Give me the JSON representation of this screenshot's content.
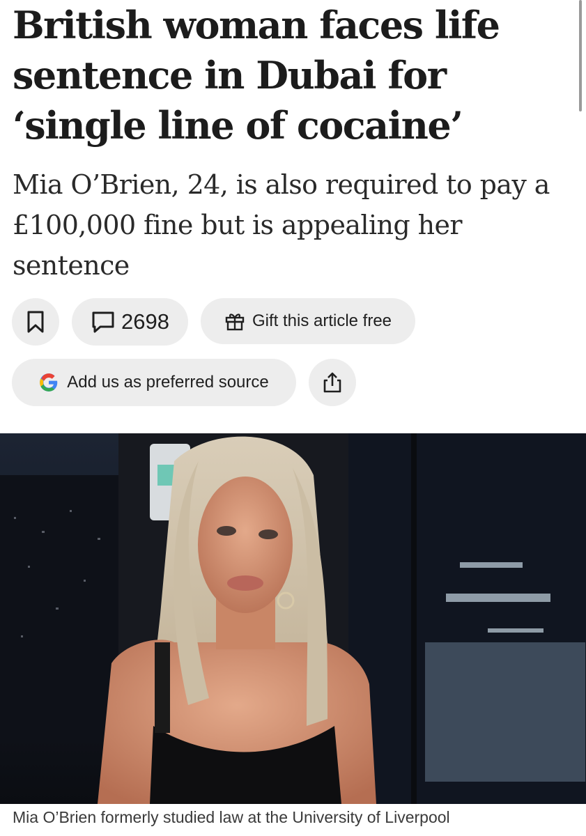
{
  "article": {
    "headline": "British woman faces life sentence in Dubai for ‘single line of cocaine’",
    "standfirst": "Mia O’Brien, 24, is also required to pay a £100,000 fine but is appealing her sentence"
  },
  "actions": {
    "comment_count": "2698",
    "gift_label": "Gift this article free",
    "preferred_source_label": "Add us as preferred source"
  },
  "icons": {
    "save": "bookmark-icon",
    "comments": "comment-bubble-icon",
    "gift": "gift-icon",
    "google": "google-g-icon",
    "share": "share-icon"
  },
  "image": {
    "caption": "Mia O’Brien formerly studied law at the University of Liverpool"
  },
  "colors": {
    "pill_background": "#ededed",
    "text": "#1a1a1a",
    "google_blue": "#4285F4",
    "google_red": "#EA4335",
    "google_yellow": "#FBBC05",
    "google_green": "#34A853"
  }
}
